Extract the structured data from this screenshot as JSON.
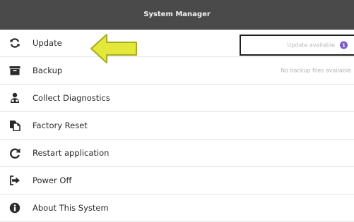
{
  "window": {
    "title": "System Manager"
  },
  "menu": {
    "items": [
      {
        "label": "Update",
        "icon": "refresh-icon",
        "status": "Update available",
        "badge": "1"
      },
      {
        "label": "Backup",
        "icon": "archive-box-icon",
        "status": "No backup files available"
      },
      {
        "label": "Collect Diagnostics",
        "icon": "user-gear-icon"
      },
      {
        "label": "Factory Reset",
        "icon": "document-copy-icon"
      },
      {
        "label": "Restart application",
        "icon": "restart-icon"
      },
      {
        "label": "Power Off",
        "icon": "sign-out-icon"
      },
      {
        "label": "About This System",
        "icon": "info-circle-icon"
      }
    ]
  },
  "colors": {
    "titlebar": "#4a4a4a",
    "badge": "#7b5cc9",
    "annotation_arrow": "#e4e83a"
  },
  "annotation": {
    "icon": "arrow-left-icon"
  }
}
